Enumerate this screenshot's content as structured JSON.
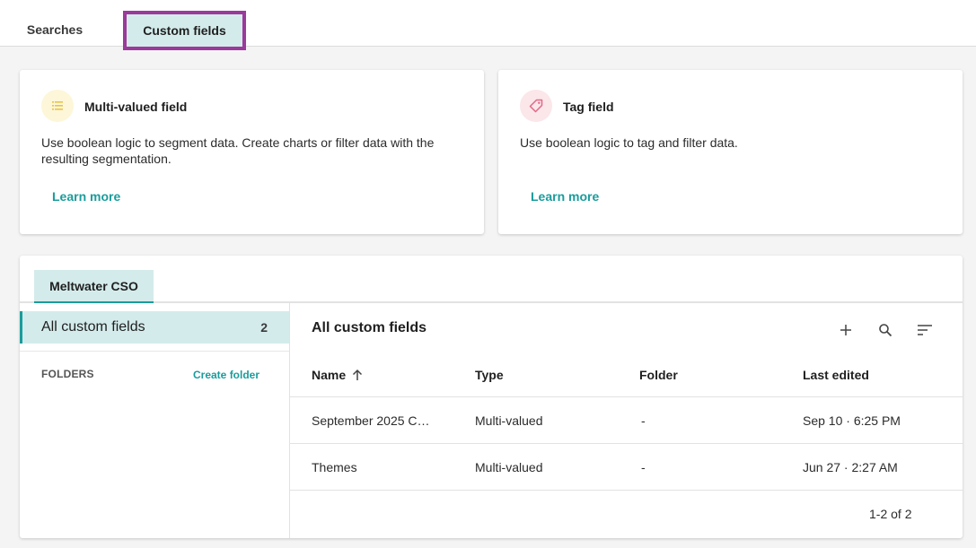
{
  "tabs": {
    "searches": "Searches",
    "custom_fields": "Custom fields"
  },
  "cards": [
    {
      "title": "Multi-valued field",
      "description": "Use boolean logic to segment data. Create charts or filter data with the resulting segmentation.",
      "link": "Learn more",
      "icon": "list-icon",
      "icon_color": "#e8c448"
    },
    {
      "title": "Tag field",
      "description": "Use boolean logic to tag and filter data.",
      "link": "Learn more",
      "icon": "tag-icon",
      "icon_color": "#e06a86"
    }
  ],
  "workspace_tab": "Meltwater CSO",
  "sidebar": {
    "all_label": "All custom fields",
    "all_count": "2",
    "folders_label": "FOLDERS",
    "create_folder": "Create folder"
  },
  "main": {
    "title": "All custom fields",
    "columns": [
      "Name",
      "Type",
      "Folder",
      "Last edited"
    ],
    "rows": [
      {
        "name": "September 2025 C…",
        "type": "Multi-valued",
        "folder": "-",
        "last_edited": "Sep 10 · 6:25 PM"
      },
      {
        "name": "Themes",
        "type": "Multi-valued",
        "folder": "-",
        "last_edited": "Jun 27 · 2:27 AM"
      }
    ],
    "pagination": "1-2 of 2"
  },
  "colors": {
    "accent": "#1a9c9c",
    "selected_bg": "#d4ebeb",
    "highlight_border": "#9b3a9b"
  }
}
